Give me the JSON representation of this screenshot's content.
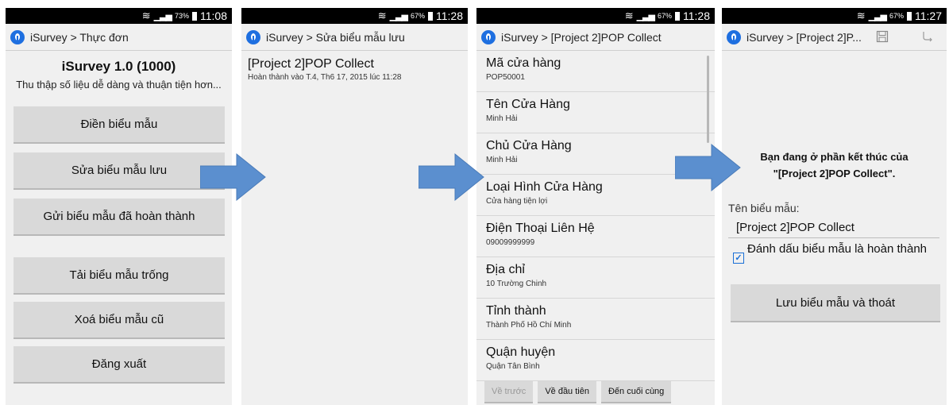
{
  "screen1": {
    "status": {
      "battery_pct": "73%",
      "time": "11:08"
    },
    "breadcrumb": "iSurvey > Thực đơn",
    "app_title": "iSurvey 1.0 (1000)",
    "app_subtitle": "Thu thập số liệu dễ dàng và thuận tiện hơn...",
    "buttons": [
      "Điền biểu mẫu",
      "Sửa biểu mẫu lưu",
      "Gửi biểu mẫu đã hoàn thành",
      "Tải biểu mẫu trống",
      "Xoá biểu mẫu cũ",
      "Đăng xuất"
    ]
  },
  "screen2": {
    "status": {
      "battery_pct": "67%",
      "time": "11:28"
    },
    "breadcrumb": "iSurvey > Sửa biểu mẫu lưu",
    "saved_form": {
      "title": "[Project 2]POP Collect",
      "subtitle": "Hoàn thành vào T.4, Th6 17, 2015 lúc 11:28"
    }
  },
  "screen3": {
    "status": {
      "battery_pct": "67%",
      "time": "11:28"
    },
    "breadcrumb": "iSurvey > [Project 2]POP Collect",
    "fields": [
      {
        "label": "Mã cửa hàng",
        "value": "POP50001"
      },
      {
        "label": "Tên Cửa Hàng",
        "value": "Minh Hải"
      },
      {
        "label": "Chủ Cửa Hàng",
        "value": "Minh Hải"
      },
      {
        "label": "Loại Hình Cửa Hàng",
        "value": "Cửa hàng tiện lợi"
      },
      {
        "label": "Điện Thoại Liên Hệ",
        "value": "09009999999"
      },
      {
        "label": "Địa chỉ",
        "value": "10 Trường Chinh"
      },
      {
        "label": "Tỉnh thành",
        "value": "Thành Phố Hồ Chí Minh"
      },
      {
        "label": "Quận huyện",
        "value": "Quận Tân Bình"
      }
    ],
    "nav": {
      "prev": "Về trước",
      "first": "Về đầu tiên",
      "last": "Đến cuối cùng"
    }
  },
  "screen4": {
    "status": {
      "battery_pct": "67%",
      "time": "11:27"
    },
    "breadcrumb": "iSurvey > [Project 2]P...",
    "finish_line1": "Bạn đang ở phần kết thúc của",
    "finish_line2": "\"[Project 2]POP Collect\".",
    "form_name_label": "Tên biểu mẫu:",
    "form_name_value": "[Project 2]POP Collect",
    "mark_complete_label": "Đánh dấu biểu mẫu là hoàn thành",
    "save_button": "Lưu biểu mẫu và thoát"
  },
  "colors": {
    "accent": "#1e6fe0",
    "arrow": "#5b8fcf"
  },
  "icons": {
    "app_logo": "info-logo-icon",
    "save": "save-icon",
    "jump": "jump-icon"
  }
}
